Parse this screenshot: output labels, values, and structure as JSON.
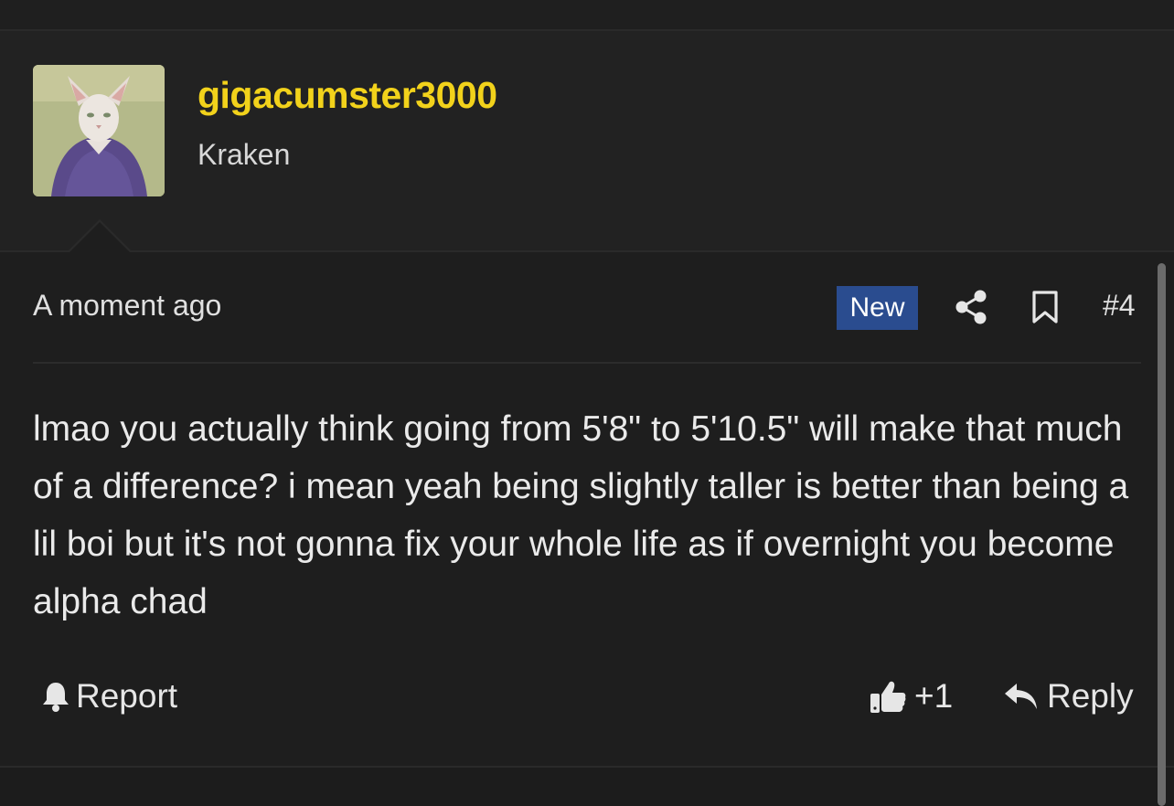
{
  "user": {
    "username": "gigacumster3000",
    "title": "Kraken",
    "avatar_desc": "avatar"
  },
  "post": {
    "time": "A moment ago",
    "badge": "New",
    "number": "#4",
    "body": "lmao you actually think going from 5'8\" to 5'10.5\" will make that much of a difference? i mean yeah being slightly taller is better than being a lil boi but it's not gonna fix your whole life as if overnight you become alpha chad",
    "report_label": "Report",
    "like_count": "+1",
    "reply_label": "Reply"
  },
  "colors": {
    "username": "#f2d21b",
    "badge_bg": "#2a4c8f",
    "bg": "#1e1e1e"
  },
  "icons": [
    "share-icon",
    "bookmark-icon",
    "bell-icon",
    "thumbs-up-icon",
    "reply-icon"
  ]
}
